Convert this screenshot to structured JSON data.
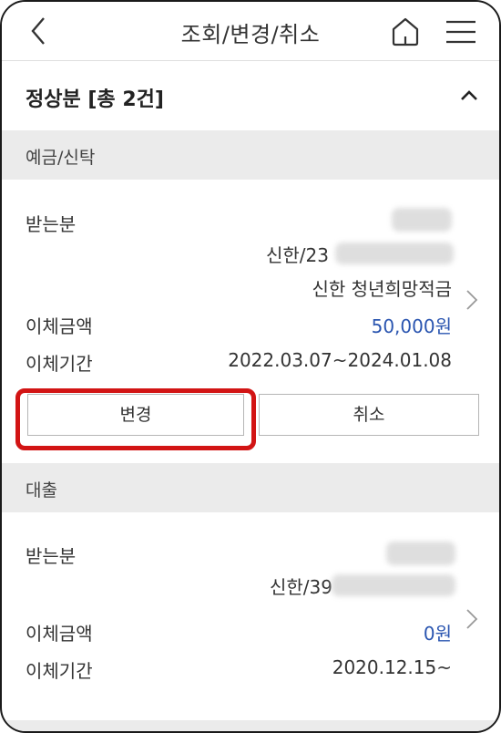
{
  "header": {
    "title": "조회/변경/취소"
  },
  "section": {
    "title": "정상분 [총 2건]"
  },
  "deposit": {
    "category": "예금/신탁",
    "recipient_label": "받는분",
    "account": "신한/23",
    "product": "신한 청년희망적금",
    "amount_label": "이체금액",
    "amount": "50,000원",
    "period_label": "이체기간",
    "period": "2022.03.07~2024.01.08",
    "change_button": "변경",
    "cancel_button": "취소"
  },
  "loan": {
    "category": "대출",
    "recipient_label": "받는분",
    "account": "신한/39",
    "amount_label": "이체금액",
    "amount": "0원",
    "period_label": "이체기간",
    "period": "2020.12.15~"
  }
}
